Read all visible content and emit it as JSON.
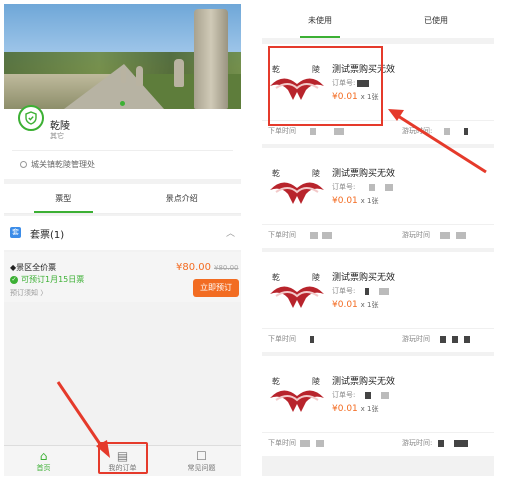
{
  "left": {
    "site": {
      "name": "乾陵",
      "category": "其它",
      "location": "城关镇乾陵管理处"
    },
    "tabs": [
      {
        "label": "票型",
        "active": true
      },
      {
        "label": "景点介绍",
        "active": false
      }
    ],
    "package": {
      "icon_label": "套",
      "name": "套票(1)"
    },
    "ticket": {
      "name": "◆景区全价票",
      "availability": "可预订1月15日票",
      "note": "预订须知 〉",
      "price": "¥80.00",
      "old_price": "¥80.00",
      "button": "立即预订"
    },
    "nav": [
      {
        "label": "首页",
        "icon": "home-icon",
        "active": true
      },
      {
        "label": "我的订单",
        "icon": "document-icon",
        "active": false
      },
      {
        "label": "常见问题",
        "icon": "chat-icon",
        "active": false
      }
    ]
  },
  "right": {
    "tabs": [
      {
        "label": "未使用",
        "active": true
      },
      {
        "label": "已使用",
        "active": false
      }
    ],
    "orders": [
      {
        "title": "测试票购买无效",
        "id_label": "订单号:",
        "price": "¥0.01",
        "qty": "x 1张",
        "order_time_label": "下单时间",
        "play_time_label": "游玩时间:"
      },
      {
        "title": "测试票购买无效",
        "id_label": "订单号:",
        "price": "¥0.01",
        "qty": "x 1张",
        "order_time_label": "下单时间",
        "play_time_label": "游玩时间"
      },
      {
        "title": "测试票购买无效",
        "id_label": "订单号:",
        "price": "¥0.01",
        "qty": "x 1张",
        "order_time_label": "下单时间",
        "play_time_label": "游玩时间"
      },
      {
        "title": "测试票购买无效",
        "id_label": "订单号:",
        "price": "¥0.01",
        "qty": "x 1张",
        "order_time_label": "下单时间",
        "play_time_label": "游玩时间:"
      }
    ]
  },
  "colors": {
    "accent": "#3cb034",
    "price": "#f36b21",
    "annotation": "#e53a2b"
  }
}
